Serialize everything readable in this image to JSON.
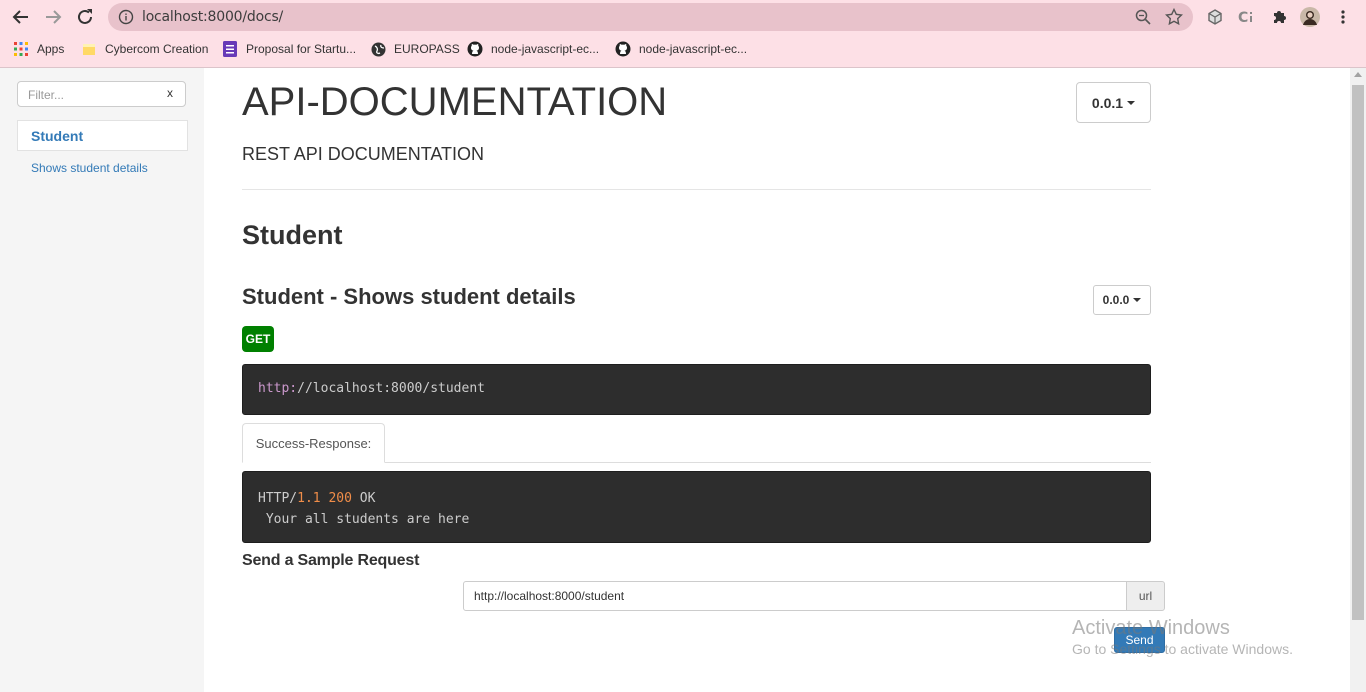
{
  "browser": {
    "url": "localhost:8000/docs/",
    "bookmarks": [
      {
        "label": "Apps",
        "icon": "apps-grid-icon"
      },
      {
        "label": "Cybercom Creation",
        "icon": "folder-icon"
      },
      {
        "label": "Proposal for Startu...",
        "icon": "forms-icon"
      },
      {
        "label": "EUROPASS",
        "icon": "globe-icon"
      },
      {
        "label": "node-javascript-ec...",
        "icon": "github-icon"
      },
      {
        "label": "node-javascript-ec...",
        "icon": "github-icon"
      }
    ]
  },
  "sidebar": {
    "filter_placeholder": "Filter...",
    "filter_clear": "x",
    "group_label": "Student",
    "item_label": "Shows student details"
  },
  "main": {
    "title": "API-DOCUMENTATION",
    "version": "0.0.1",
    "subtitle": "REST API DOCUMENTATION",
    "section_title": "Student",
    "endpoint_title": "Student - Shows student details",
    "endpoint_version": "0.0.0",
    "method": "GET",
    "url_protocol": "http:",
    "url_rest": "//localhost:8000/student",
    "tab_label": "Success-Response:",
    "response": {
      "proto": "HTTP/",
      "version": "1.1",
      "status": "200",
      "status_text": "OK",
      "body": " Your all students are here"
    },
    "sample_title": "Send a Sample Request",
    "sample_url": "http://localhost:8000/student",
    "url_addon": "url",
    "send_label": "Send"
  },
  "watermark": {
    "line1": "Activate Windows",
    "line2": "Go to Settings to activate Windows."
  },
  "colors": {
    "chrome_bg": "#fde0e6",
    "omnibox_bg": "#e8c2cb",
    "link": "#337ab7",
    "get_badge": "#008000",
    "code_bg": "#2d2d2d"
  }
}
